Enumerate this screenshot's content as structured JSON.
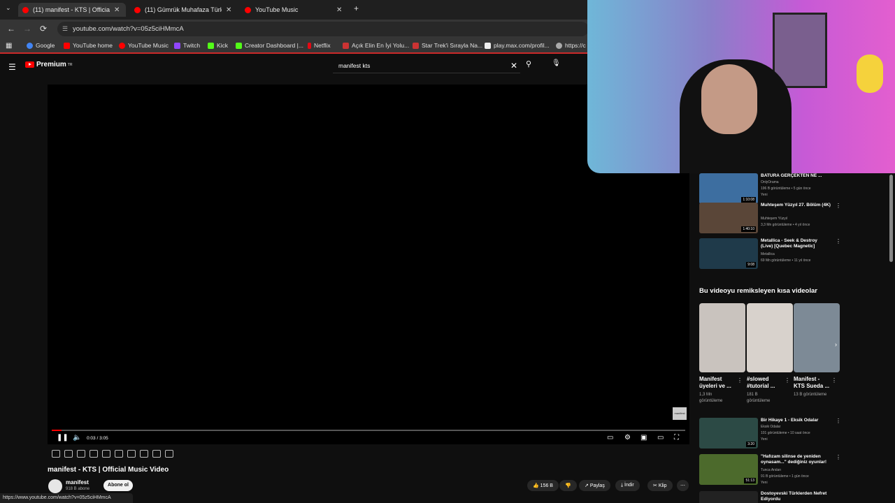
{
  "tabs": [
    {
      "title": "(11) manifest - KTS | Official M...",
      "active": true
    },
    {
      "title": "(11) Gümrük Muhafaza Türkiye...",
      "active": false
    },
    {
      "title": "YouTube Music",
      "active": false
    }
  ],
  "address": {
    "url": "youtube.com/watch?v=05z5ciHMmcA"
  },
  "bookmarks": [
    {
      "label": "Google",
      "color": "#4285f4"
    },
    {
      "label": "YouTube home",
      "color": "#ff0000"
    },
    {
      "label": "YouTube Music",
      "color": "#ff0000"
    },
    {
      "label": "Twitch",
      "color": "#9146ff"
    },
    {
      "label": "Kick",
      "color": "#53fc18"
    },
    {
      "label": "Creator Dashboard |...",
      "color": "#53fc18"
    },
    {
      "label": "Netflix",
      "color": "#e50914"
    },
    {
      "label": "Açık Elin En İyi Yolu...",
      "color": "#d33"
    },
    {
      "label": "Star Trek'i Sırayla Na...",
      "color": "#d33"
    },
    {
      "label": "play.max.com/profil...",
      "color": "#fff"
    },
    {
      "label": "https://c",
      "color": "#aaa"
    }
  ],
  "youtube": {
    "brand": "Premium",
    "region": "TR",
    "search_value": "manifest kts"
  },
  "player": {
    "time": "0:03 / 3:05",
    "progress_fraction": 0.016,
    "watermark": "manifest"
  },
  "video": {
    "title": "manifest - KTS | Official Music Video",
    "channel": "manifest",
    "subscribers": "918 B abone",
    "subscribe_label": "Abone ol",
    "likes": "156 B",
    "share_label": "Paylaş",
    "download_label": "İndir",
    "clip_label": "Klip"
  },
  "status_url": "https://www.youtube.com/watch?v=05z5ciHMmcA",
  "recommended_top": [
    {
      "title": "BATURA GERÇEKTEN NE ...",
      "channel": "OnlyOrama",
      "meta": "196 B görüntüleme • 5 gün önce",
      "badge": "Yeni",
      "duration": "1:10:08"
    },
    {
      "title": "Muhteşem Yüzyıl 27. Bölüm (4K)",
      "channel": "Muhteşem Yüzyıl",
      "meta": "3,3 Mn görüntüleme • 4 yıl önce",
      "badge": "",
      "duration": "1:40:10"
    },
    {
      "title": "Metallica - Seek & Destroy (Live) [Quebec Magnetic]",
      "channel": "Metallica",
      "meta": "69 Mn görüntüleme • 11 yıl önce",
      "badge": "",
      "duration": "9:08"
    }
  ],
  "shorts_heading": "Bu videoyu remiksleyen kısa videolar",
  "shorts": [
    {
      "title": "Manifest üyeleri ve ...",
      "views": "1,3 Mn görüntüleme"
    },
    {
      "title": "#slowed #tutorial ...",
      "views": "181 B görüntüleme"
    },
    {
      "title": "Manifest - KTS Sueda ...",
      "views": "13 B görüntüleme"
    }
  ],
  "recommended_bottom": [
    {
      "title": "Bir Hikaye 1 - Eksik Odalar",
      "channel": "Eksik Odalar",
      "meta": "101 görüntüleme • 10 saat önce",
      "badge": "Yeni",
      "duration": "3:20"
    },
    {
      "title": "\"Hafızam silinse de yeniden oynasam...\" dediğiniz oyunlar!",
      "channel": "Tunca Arslan",
      "meta": "91 B görüntüleme • 1 gün önce",
      "badge": "Yeni",
      "duration": "51:13"
    },
    {
      "title": "Dostoyevski Türklerden Nefret Ediyordu",
      "channel": "",
      "meta": "",
      "badge": "",
      "duration": ""
    }
  ]
}
